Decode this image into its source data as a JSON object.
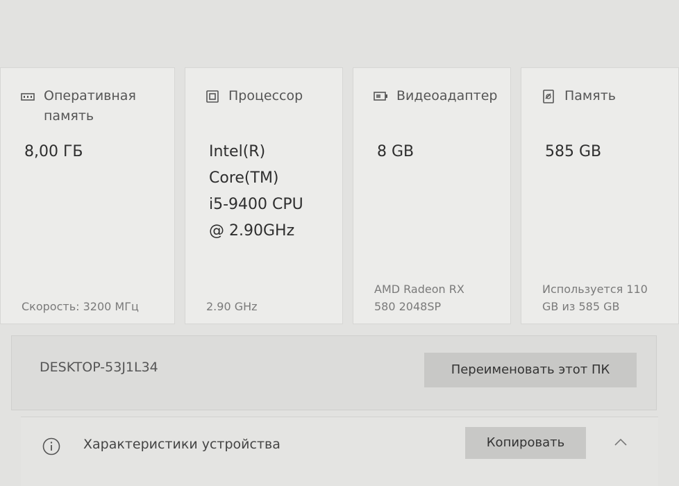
{
  "cards": [
    {
      "id": "ram",
      "icon": "memory-module-icon",
      "title": "Оперативная\nпамять",
      "value": "8,00 ГБ",
      "footer": "Скорость: 3200 МГц"
    },
    {
      "id": "cpu",
      "icon": "processor-icon",
      "title": "Процессор",
      "value": "Intel(R)\nCore(TM)\ni5-9400 CPU\n@ 2.90GHz",
      "footer": "2.90 GHz"
    },
    {
      "id": "gpu",
      "icon": "video-adapter-icon",
      "title": "Видеоадаптер",
      "value": "8 GB",
      "footer": "AMD Radeon RX\n580 2048SP"
    },
    {
      "id": "storage",
      "icon": "storage-drive-icon",
      "title": "Память",
      "value": "585 GB",
      "footer": "Используется 110\nGB из 585 GB"
    }
  ],
  "device": {
    "name": "DESKTOP-53J1L34",
    "rename_label": "Переименовать этот ПК"
  },
  "specs": {
    "icon": "info-icon",
    "title": "Характеристики устройства",
    "copy_label": "Копировать",
    "chevron_icon": "chevron-up-icon"
  }
}
